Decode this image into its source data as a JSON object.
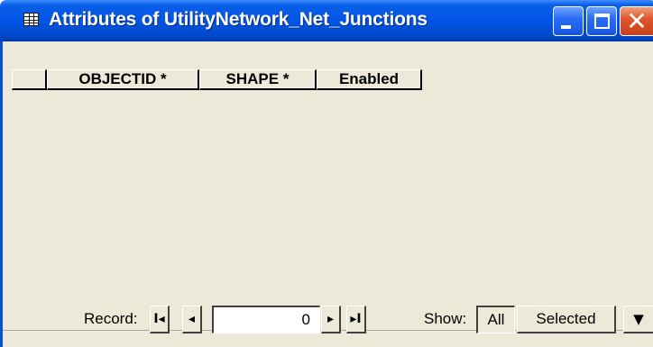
{
  "window": {
    "title": "Attributes of UtilityNetwork_Net_Junctions",
    "icon": "table-icon",
    "minimize_icon": "minimize-icon",
    "maximize_icon": "maximize-icon",
    "close_icon": "close-icon"
  },
  "table": {
    "columns": [
      "OBJECTID *",
      "SHAPE *",
      "Enabled"
    ],
    "rows": []
  },
  "navigation": {
    "record_label": "Record:",
    "first_glyph": "I◂",
    "prev_glyph": "◂",
    "next_glyph": "▸",
    "last_glyph": "▸I",
    "record_value": "0",
    "show_label": "Show:",
    "show_all_label": "All",
    "show_selected_label": "Selected",
    "options_glyph": "▼"
  },
  "colors": {
    "titlebar": "#0055e5",
    "client_background": "#ece9d8",
    "close_button": "#e0572e"
  }
}
